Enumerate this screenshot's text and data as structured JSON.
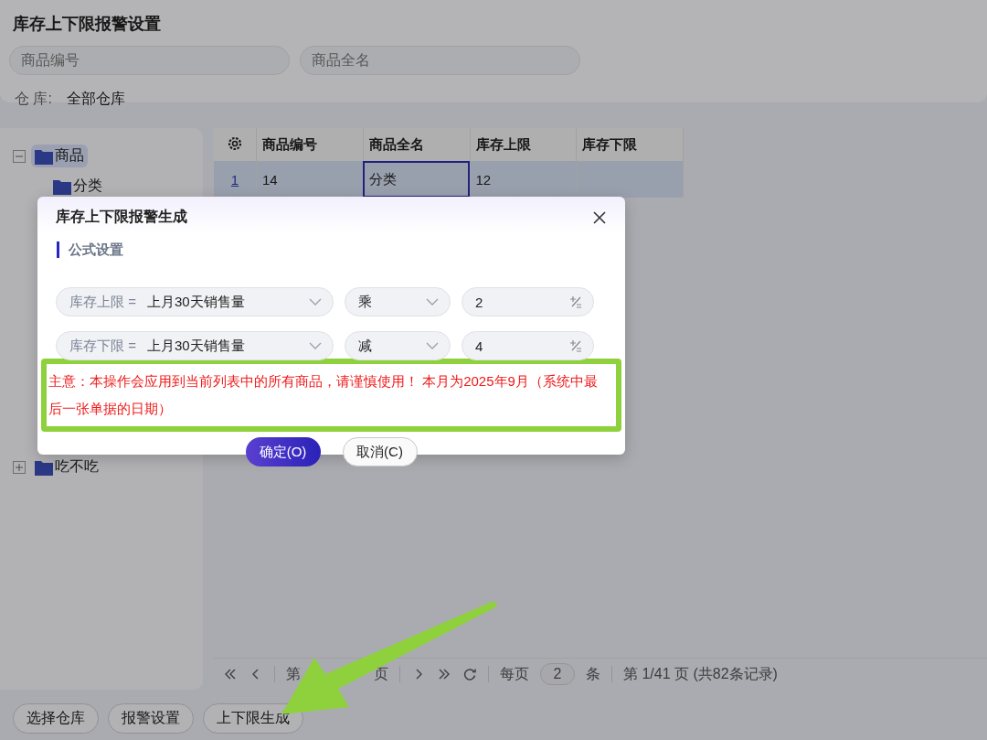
{
  "page": {
    "title": "库存上下限报警设置"
  },
  "filters": {
    "fields": [
      {
        "placeholder": "商品编号"
      },
      {
        "placeholder": "商品全名"
      }
    ],
    "warehouse_label": "仓 库:",
    "warehouse_value": "全部仓库"
  },
  "tree": [
    {
      "label": "商品",
      "expanded": true,
      "selected": true,
      "children": [
        {
          "label": "分类",
          "expanded": false,
          "selected": false
        }
      ]
    },
    {
      "label": "吃不吃",
      "expanded": false,
      "selected": false
    }
  ],
  "table": {
    "columns": [
      "商品编号",
      "商品全名",
      "库存上限",
      "库存下限"
    ],
    "rows": [
      {
        "index": "1",
        "selected": true,
        "cells": [
          {
            "text": "14",
            "focused": false
          },
          {
            "text": "分类",
            "focused": true
          },
          {
            "text": "12",
            "focused": false
          }
        ]
      }
    ]
  },
  "pager": {
    "page_prefix": "第",
    "page_suffix": "页",
    "per_page_label": "每页",
    "per_page_value": "2",
    "per_page_unit": "条",
    "summary": "第 1/41 页 (共82条记录)"
  },
  "footer_buttons": [
    "选择仓库",
    "报警设置",
    "上下限生成"
  ],
  "dialog": {
    "title": "库存上下限报警生成",
    "section": "公式设置",
    "rules": [
      {
        "label": "库存上限 =",
        "source": "上月30天销售量",
        "operator": "乘",
        "value": "2"
      },
      {
        "label": "库存下限 =",
        "source": "上月30天销售量",
        "operator": "减",
        "value": "4"
      }
    ],
    "notice": "主意：本操作会应用到当前列表中的所有商品，请谨慎使用！ 本月为2025年9月（系统中最后一张单据的日期）",
    "buttons": [
      {
        "label": "确定(O)",
        "kind": "primary"
      },
      {
        "label": "取消(C)",
        "kind": "secondary"
      }
    ]
  }
}
